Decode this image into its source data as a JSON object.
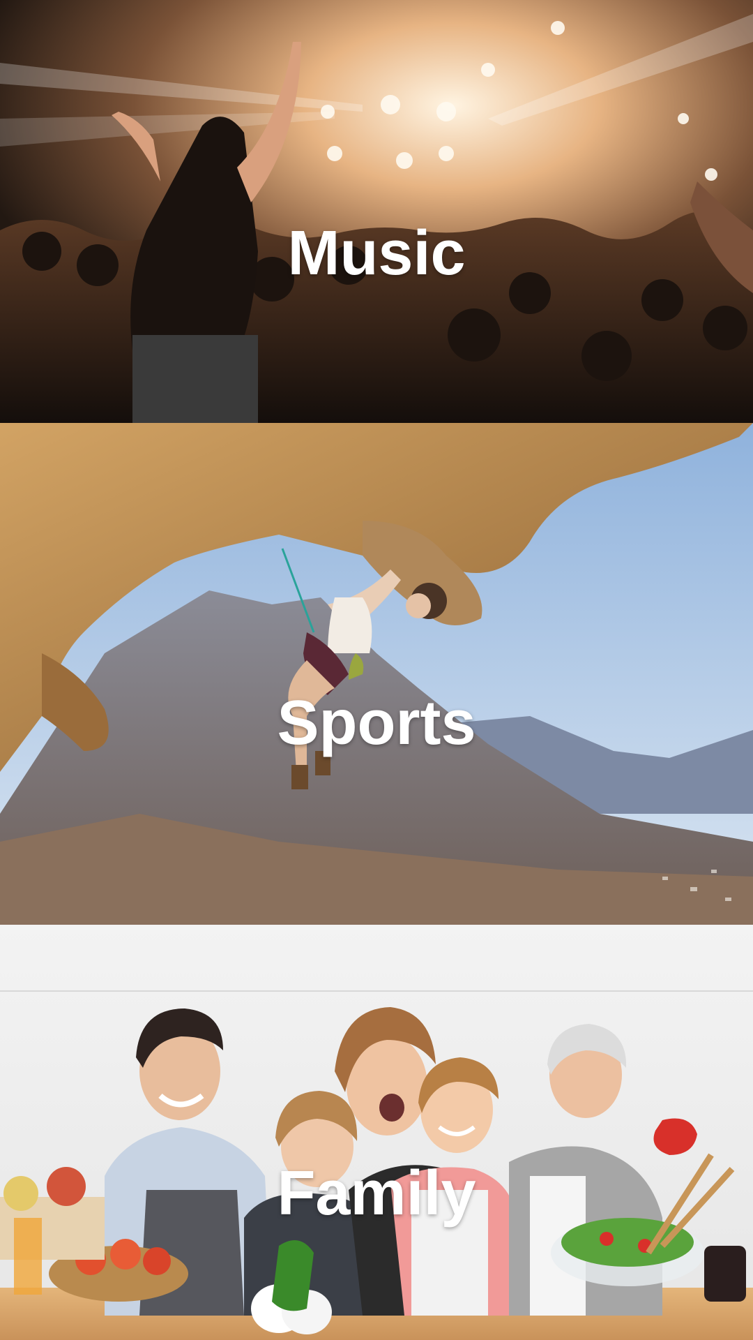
{
  "categories": [
    {
      "label": "Music",
      "scene": "concert-crowd-photo"
    },
    {
      "label": "Sports",
      "scene": "rock-climbing-photo"
    },
    {
      "label": "Family",
      "scene": "family-kitchen-photo"
    }
  ],
  "colors": {
    "label_text": "#ffffff",
    "music_warm": "#c98a55",
    "sports_sky": "#b9d2ec",
    "sports_rock": "#b98a4e",
    "family_counter": "#d9a76a"
  }
}
